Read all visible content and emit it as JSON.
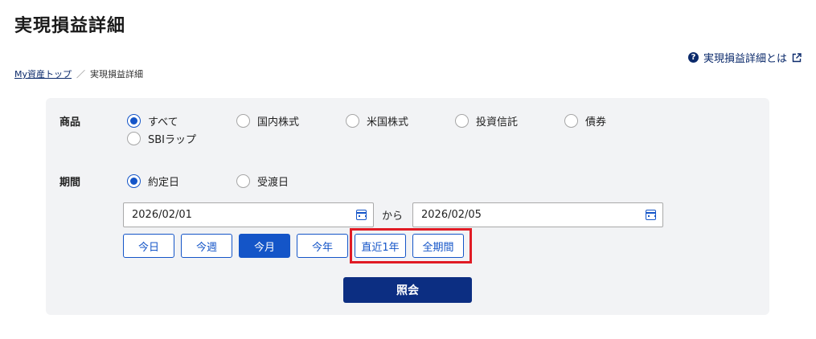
{
  "page_title": "実現損益詳細",
  "help_link": {
    "label": "実現損益詳細とは"
  },
  "breadcrumb": {
    "home": "My資産トップ",
    "separator": "／",
    "current": "実現損益詳細"
  },
  "product": {
    "label": "商品",
    "options": [
      {
        "label": "すべて",
        "checked": true
      },
      {
        "label": "国内株式",
        "checked": false
      },
      {
        "label": "米国株式",
        "checked": false
      },
      {
        "label": "投資信託",
        "checked": false
      },
      {
        "label": "債券",
        "checked": false
      },
      {
        "label": "SBIラップ",
        "checked": false
      }
    ]
  },
  "period": {
    "label": "期間",
    "options": [
      {
        "label": "約定日",
        "checked": true
      },
      {
        "label": "受渡日",
        "checked": false
      }
    ],
    "from_date": "2026/02/01",
    "to_label": "から",
    "to_date": "2026/02/05",
    "quick_buttons": [
      {
        "label": "今日",
        "active": false
      },
      {
        "label": "今週",
        "active": false
      },
      {
        "label": "今月",
        "active": true
      },
      {
        "label": "今年",
        "active": false
      },
      {
        "label": "直近1年",
        "active": false
      },
      {
        "label": "全期間",
        "active": false
      }
    ]
  },
  "submit_label": "照会",
  "colors": {
    "primary": "#1455c8",
    "navy": "#0c2e82",
    "highlight": "#e01b24",
    "panel_bg": "#f2f3f5"
  }
}
